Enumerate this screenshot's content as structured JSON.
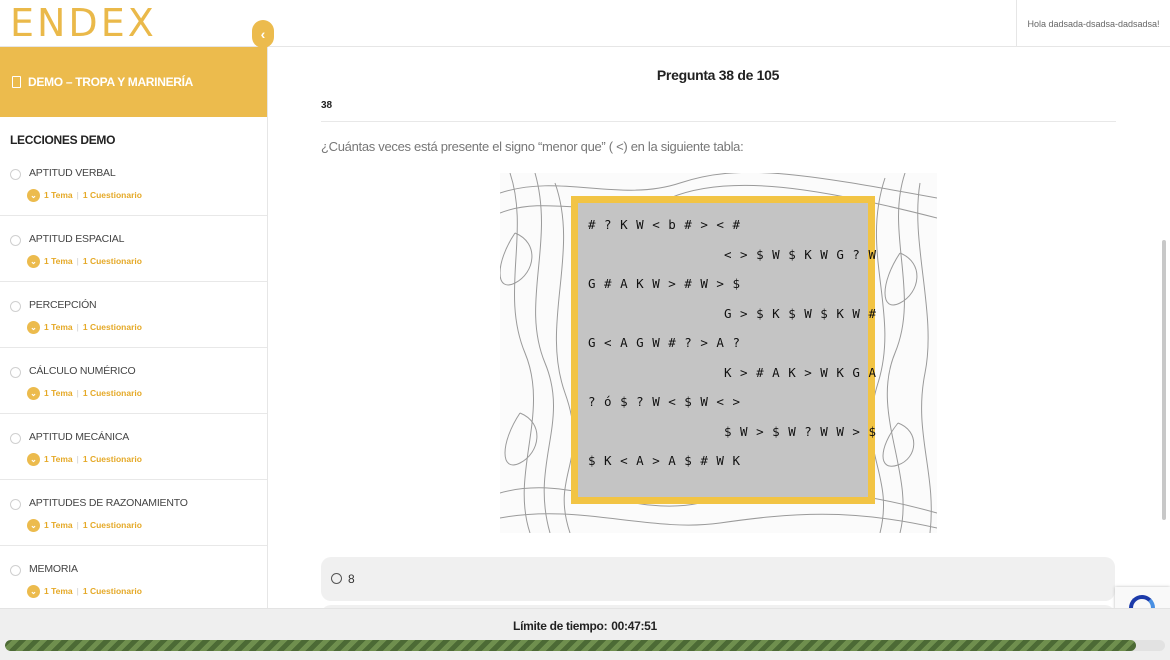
{
  "header": {
    "logo": "ENDEX",
    "greeting": "Hola dadsada-dsadsa-dadsadsa!"
  },
  "sidebar": {
    "course_title": "DEMO – TROPA Y MARINERÍA",
    "collapse_icon": "chevron-left-icon",
    "section_title": "LECCIONES DEMO",
    "lessons": [
      {
        "name": "APTITUD VERBAL",
        "topics": "1 Tema",
        "quizzes": "1 Cuestionario"
      },
      {
        "name": "APTITUD ESPACIAL",
        "topics": "1 Tema",
        "quizzes": "1 Cuestionario"
      },
      {
        "name": "PERCEPCIÓN",
        "topics": "1 Tema",
        "quizzes": "1 Cuestionario"
      },
      {
        "name": "CÁLCULO NUMÉRICO",
        "topics": "1 Tema",
        "quizzes": "1 Cuestionario"
      },
      {
        "name": "APTITUD MECÁNICA",
        "topics": "1 Tema",
        "quizzes": "1 Cuestionario"
      },
      {
        "name": "APTITUDES DE RAZONAMIENTO",
        "topics": "1 Tema",
        "quizzes": "1 Cuestionario"
      },
      {
        "name": "MEMORIA",
        "topics": "1 Tema",
        "quizzes": "1 Cuestionario"
      }
    ]
  },
  "question": {
    "heading": "Pregunta 38 de 105",
    "number": "38",
    "text": "¿Cuántas veces está presente el signo “menor que” ( <) en la siguiente tabla:",
    "board_rows": [
      "# ? K W < b # > < #",
      "< > $ W $ K W G ? W",
      "G # A K W > # W > $",
      "G > $ K $ W $ K W #",
      "G < A G W # ? > A ?",
      "K > # A K > W K G A",
      "? ó $ ? W < $ W < >",
      "$ W > $ W ? W W > $",
      "$ K < A > A $ # W K"
    ],
    "options": [
      {
        "label": "8"
      }
    ]
  },
  "colors": {
    "brand": "#ecbb4d",
    "progress": "#4c6a35"
  },
  "footer": {
    "timer_label": "Límite de tiempo:",
    "timer_value": "00:47:51",
    "progress_fraction": 0.975
  }
}
